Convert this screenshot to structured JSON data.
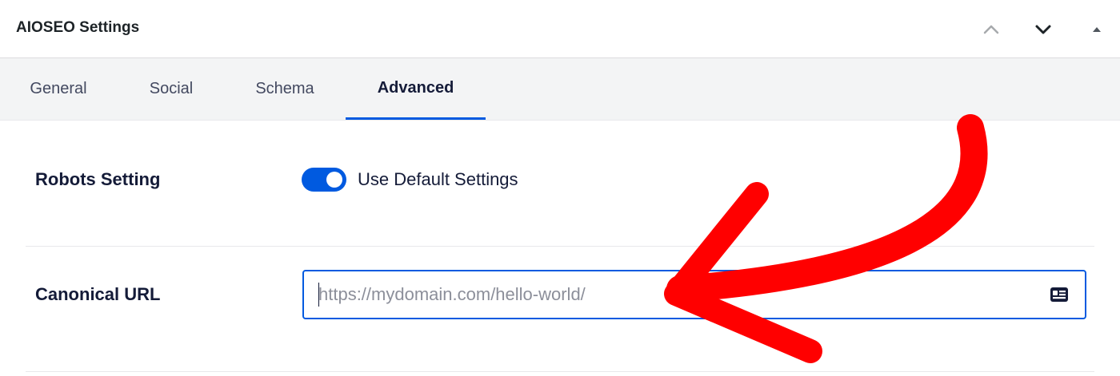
{
  "header": {
    "title": "AIOSEO Settings",
    "buttons": {
      "move_up_icon": "chevron-up-icon",
      "move_down_icon": "chevron-down-icon",
      "toggle_panel_icon": "triangle-up-icon"
    }
  },
  "tabs": [
    {
      "label": "General",
      "active": false
    },
    {
      "label": "Social",
      "active": false
    },
    {
      "label": "Schema",
      "active": false
    },
    {
      "label": "Advanced",
      "active": true
    }
  ],
  "robots": {
    "label": "Robots Setting",
    "toggle_on": true,
    "toggle_label": "Use Default Settings"
  },
  "canonical": {
    "label": "Canonical URL",
    "value": "",
    "placeholder": "https://mydomain.com/hello-world/",
    "icon": "id-card-icon"
  },
  "colors": {
    "accent": "#005ae0",
    "arrow": "#ff0000",
    "text": "#141b38"
  }
}
